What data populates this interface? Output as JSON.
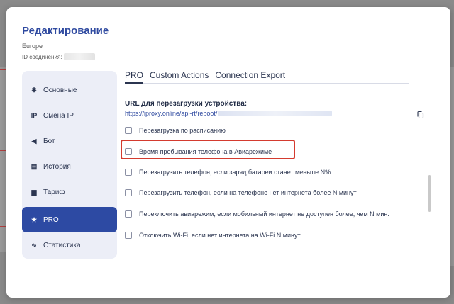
{
  "modal": {
    "title": "Редактирование",
    "region": "Europe",
    "connection_id_label": "ID соединения:"
  },
  "sidebar": {
    "items": [
      {
        "label": "Основные",
        "icon": "gear-icon",
        "glyph": "✱",
        "active": false
      },
      {
        "label": "Смена IP",
        "icon": "ip-icon",
        "glyph": "IP",
        "active": false
      },
      {
        "label": "Бот",
        "icon": "paper-plane-icon",
        "glyph": "◀",
        "active": false
      },
      {
        "label": "История",
        "icon": "document-icon",
        "glyph": "▤",
        "active": false
      },
      {
        "label": "Тариф",
        "icon": "shopping-bag-icon",
        "glyph": "▆",
        "active": false
      },
      {
        "label": "PRO",
        "icon": "star-icon",
        "glyph": "★",
        "active": true
      },
      {
        "label": "Статистика",
        "icon": "pulse-icon",
        "glyph": "∿",
        "active": false
      }
    ]
  },
  "tabs": [
    {
      "label": "PRO",
      "active": true
    },
    {
      "label": "Custom Actions",
      "active": false
    },
    {
      "label": "Connection Export",
      "active": false
    }
  ],
  "pro": {
    "url_label": "URL для перезагрузки устройства:",
    "url_value": "https://iproxy.online/api-rt/reboot/",
    "options": [
      {
        "label": "Перезагрузка по расписанию",
        "checked": false
      },
      {
        "label": "Время пребывания телефона в Авиарежиме",
        "checked": false,
        "highlighted": true
      },
      {
        "label": "Перезагрузить телефон, если заряд батареи станет меньше N%",
        "checked": false
      },
      {
        "label": "Перезагрузить телефон, если на телефоне нет интернета более N минут",
        "checked": false
      },
      {
        "label": "Переключить авиарежим, если мобильный интернет не доступен более, чем N мин.",
        "checked": false
      },
      {
        "label": "Отключить Wi-Fi, если нет интернета на Wi-Fi N минут",
        "checked": false
      }
    ]
  },
  "colors": {
    "accent": "#2d4aa3",
    "highlight": "#d43b2f",
    "sidebar_bg": "#eceef7"
  }
}
